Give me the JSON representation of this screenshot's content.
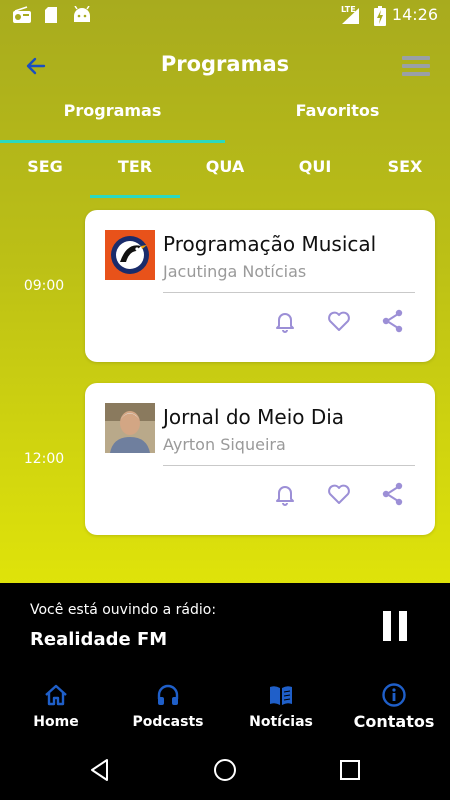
{
  "status_bar": {
    "time": "14:26",
    "network": "LTE",
    "icons": [
      "radio-icon",
      "sd-card-icon",
      "android-icon",
      "signal-icon",
      "battery-charging-icon"
    ]
  },
  "header": {
    "title": "Programas",
    "back_icon": "arrow-left-icon",
    "menu_icon": "hamburger-menu-icon"
  },
  "tabs": [
    {
      "label": "Programas",
      "active": true
    },
    {
      "label": "Favoritos",
      "active": false
    }
  ],
  "days": [
    {
      "label": "SEG",
      "active": false
    },
    {
      "label": "TER",
      "active": true
    },
    {
      "label": "QUA",
      "active": false
    },
    {
      "label": "QUI",
      "active": false
    },
    {
      "label": "SEX",
      "active": false
    }
  ],
  "schedule": [
    {
      "time": "09:00",
      "title": "Programação Musical",
      "host": "Jacutinga Notícias",
      "image": "station-logo"
    },
    {
      "time": "12:00",
      "title": "Jornal do Meio Dia",
      "host": "Ayrton Siqueira",
      "image": "host-photo"
    }
  ],
  "card_actions": [
    "bell-icon",
    "heart-icon",
    "share-icon"
  ],
  "player": {
    "caption": "Você está ouvindo a rádio:",
    "station": "Realidade FM",
    "state_icon": "pause-icon"
  },
  "bottom_nav": [
    {
      "label": "Home",
      "icon": "home-icon"
    },
    {
      "label": "Podcasts",
      "icon": "headphones-icon"
    },
    {
      "label": "Notícias",
      "icon": "book-icon"
    },
    {
      "label": "Contatos",
      "icon": "info-icon"
    }
  ],
  "colors": {
    "accent": "#2bd9c0",
    "gradient_top": "#a8ab1e",
    "gradient_bottom": "#dfe30a",
    "action_icon": "#9c8fd6",
    "nav_icon": "#1f5fc9"
  }
}
